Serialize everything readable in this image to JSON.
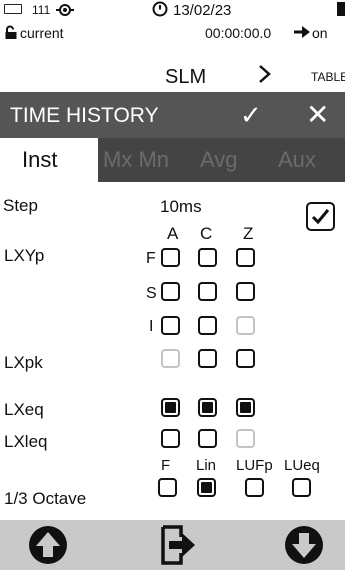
{
  "status": {
    "num": "111",
    "date": "13/02/23"
  },
  "info": {
    "lock_label": "current",
    "timer": "00:00:00.0",
    "on_label": "on"
  },
  "nav": {
    "title": "SLM",
    "next_label": "TABLE"
  },
  "header": {
    "title": "TIME HISTORY",
    "check_label": "✓",
    "close_label": "✕"
  },
  "tabs": [
    "Inst",
    "Mx Mn",
    "Avg",
    "Aux"
  ],
  "settings": {
    "step_label": "Step",
    "step_value": "10ms",
    "columns": [
      "A",
      "C",
      "Z"
    ],
    "lxyp_label": "LXYp",
    "f_label": "F",
    "s_label": "S",
    "i_label": "I",
    "lxpk_label": "LXpk",
    "lxeq_label": "LXeq",
    "lxleq_label": "LXleq",
    "octave_label": "1/3 Octave",
    "octave_columns": [
      "F",
      "Lin",
      "LUFp",
      "LUeq"
    ]
  },
  "colors": {
    "title_bar": "#555555",
    "tab_bar": "#444444",
    "bottom_bar": "#c9c9c9"
  }
}
